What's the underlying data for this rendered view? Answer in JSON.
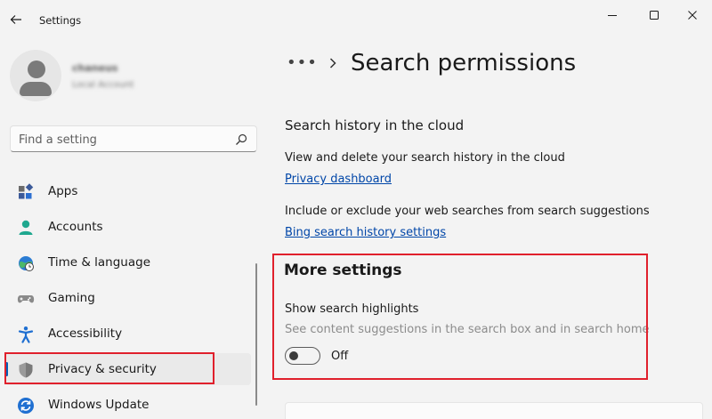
{
  "window": {
    "title": "Settings"
  },
  "profile": {
    "name": "chaneus",
    "account_type": "Local Account"
  },
  "search": {
    "placeholder": "Find a setting"
  },
  "sidebar": {
    "items": [
      {
        "label": "Apps",
        "icon": "apps-icon"
      },
      {
        "label": "Accounts",
        "icon": "accounts-icon"
      },
      {
        "label": "Time & language",
        "icon": "time-language-icon"
      },
      {
        "label": "Gaming",
        "icon": "gaming-icon"
      },
      {
        "label": "Accessibility",
        "icon": "accessibility-icon"
      },
      {
        "label": "Privacy & security",
        "icon": "shield-icon",
        "selected": true
      },
      {
        "label": "Windows Update",
        "icon": "windows-update-icon"
      }
    ]
  },
  "breadcrumb": {
    "more": "•••",
    "page_title": "Search permissions"
  },
  "cloud_history": {
    "heading": "Search history in the cloud",
    "view_delete_text": "View and delete your search history in the cloud",
    "privacy_dashboard_link": "Privacy dashboard",
    "include_exclude_text": "Include or exclude your web searches from search suggestions",
    "bing_history_link": "Bing search history settings"
  },
  "more_settings": {
    "heading": "More settings",
    "highlights_label": "Show search highlights",
    "highlights_desc": "See content suggestions in the search box and in search home",
    "toggle_state": "Off"
  },
  "colors": {
    "accent": "#005fb8",
    "highlight_border": "#e0202c",
    "link": "#0046a8"
  }
}
